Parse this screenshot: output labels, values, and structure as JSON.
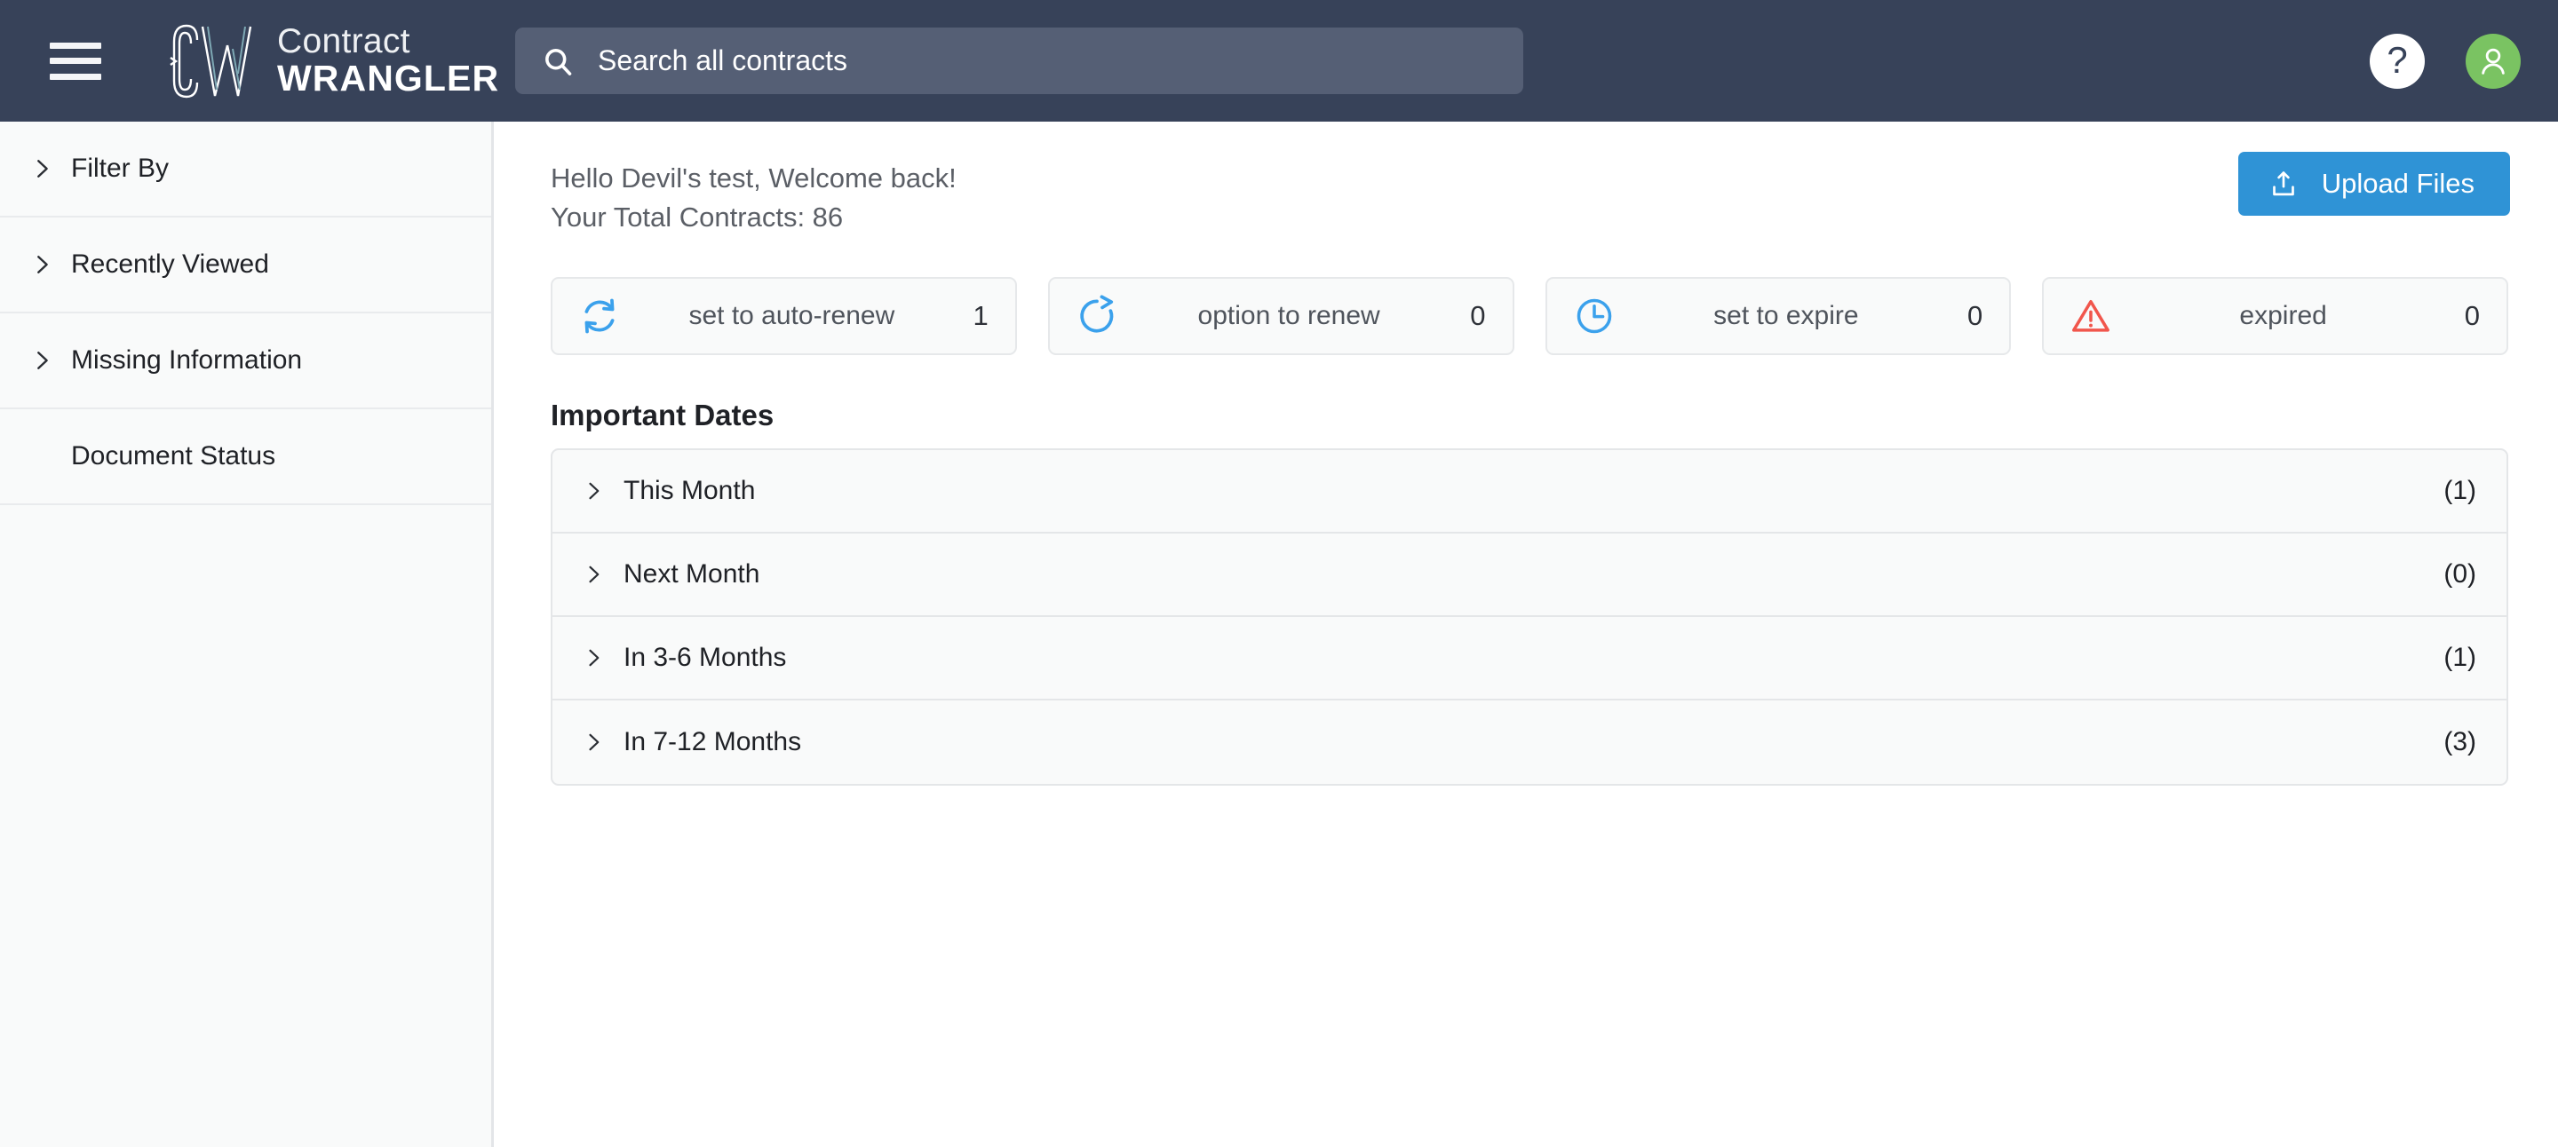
{
  "brand": {
    "line1": "Contract",
    "line2": "WRANGLER",
    "logo_icon": "cw-monogram-icon"
  },
  "header": {
    "menu_icon": "hamburger-menu-icon",
    "help_label": "?",
    "help_icon": "question-mark-icon",
    "avatar_icon": "user-avatar-icon",
    "background_color": "#374259"
  },
  "search": {
    "placeholder": "Search all contracts",
    "value": "",
    "icon": "search-icon"
  },
  "sidebar": {
    "items": [
      {
        "label": "Filter By",
        "chevron": "chevron-right-icon",
        "has_chevron": true
      },
      {
        "label": "Recently Viewed",
        "chevron": "chevron-right-icon",
        "has_chevron": true
      },
      {
        "label": "Missing Information",
        "chevron": "chevron-right-icon",
        "has_chevron": true
      },
      {
        "label": "Document Status",
        "chevron": "",
        "has_chevron": false
      }
    ]
  },
  "main": {
    "greeting_line1": "Hello Devil's test, Welcome back!",
    "greeting_line2": "Your Total Contracts: 86",
    "upload_button_label": "Upload Files",
    "upload_button_icon": "upload-icon",
    "upload_button_color": "#2f93d6",
    "section_title": "Important Dates",
    "status_cards": [
      {
        "label": "set to auto-renew",
        "count": "1",
        "icon": "auto-renew-loop-icon",
        "icon_color": "#3ba1ec"
      },
      {
        "label": "option to renew",
        "count": "0",
        "icon": "refresh-arrow-icon",
        "icon_color": "#3ba1ec"
      },
      {
        "label": "set to expire",
        "count": "0",
        "icon": "clock-icon",
        "icon_color": "#3ba1ec"
      },
      {
        "label": "expired",
        "count": "0",
        "icon": "warning-triangle-icon",
        "icon_color": "#f1564c"
      }
    ],
    "date_rows": [
      {
        "label": "This Month",
        "count": "(1)",
        "chevron": "chevron-right-icon"
      },
      {
        "label": "Next Month",
        "count": "(0)",
        "chevron": "chevron-right-icon"
      },
      {
        "label": "In 3-6 Months",
        "count": "(1)",
        "chevron": "chevron-right-icon"
      },
      {
        "label": "In 7-12 Months",
        "count": "(3)",
        "chevron": "chevron-right-icon"
      }
    ]
  }
}
